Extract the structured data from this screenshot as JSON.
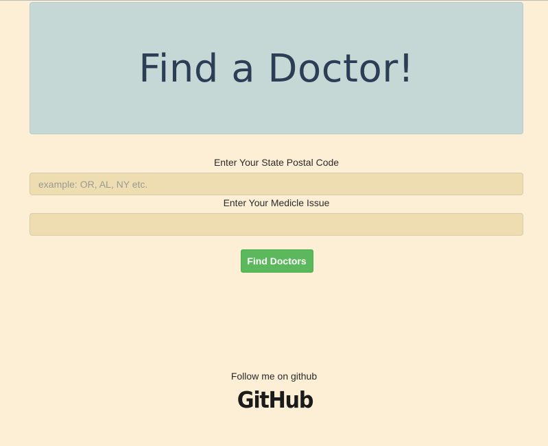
{
  "header": {
    "title": "Find a Doctor!"
  },
  "form": {
    "state_label": "Enter Your State Postal Code",
    "state_placeholder": "example: OR, AL, NY etc.",
    "state_value": "",
    "issue_label": "Enter Your Medicle Issue",
    "issue_placeholder": "",
    "issue_value": "",
    "submit_label": "Find Doctors"
  },
  "footer": {
    "text": "Follow me on github",
    "logo_text": "GitHub"
  },
  "colors": {
    "background": "#fdefd5",
    "jumbotron": "#c5d8d5",
    "title": "#2c3e56",
    "input_bg": "#efddb2",
    "button": "#5cb85c"
  }
}
